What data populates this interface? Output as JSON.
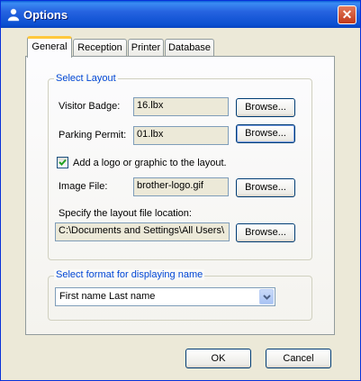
{
  "window": {
    "title": "Options",
    "close_label": "✕"
  },
  "tabs": [
    {
      "label": "General",
      "active": true
    },
    {
      "label": "Reception",
      "active": false
    },
    {
      "label": "Printer",
      "active": false
    },
    {
      "label": "Database",
      "active": false
    }
  ],
  "layout_group": {
    "title": "Select Layout",
    "visitor_badge": {
      "label": "Visitor Badge:",
      "value": "16.lbx",
      "browse": "Browse..."
    },
    "parking_permit": {
      "label": "Parking Permit:",
      "value": "01.lbx",
      "browse": "Browse..."
    },
    "add_logo": {
      "label": "Add a logo or graphic to the layout.",
      "checked": true
    },
    "image_file": {
      "label": "Image File:",
      "value": "brother-logo.gif",
      "browse": "Browse..."
    },
    "location": {
      "label": "Specify the layout file location:",
      "value": "C:\\Documents and Settings\\All Users\\",
      "browse": "Browse..."
    }
  },
  "name_group": {
    "title": "Select format for displaying name",
    "selected": "First name Last name"
  },
  "buttons": {
    "ok": "OK",
    "cancel": "Cancel"
  }
}
